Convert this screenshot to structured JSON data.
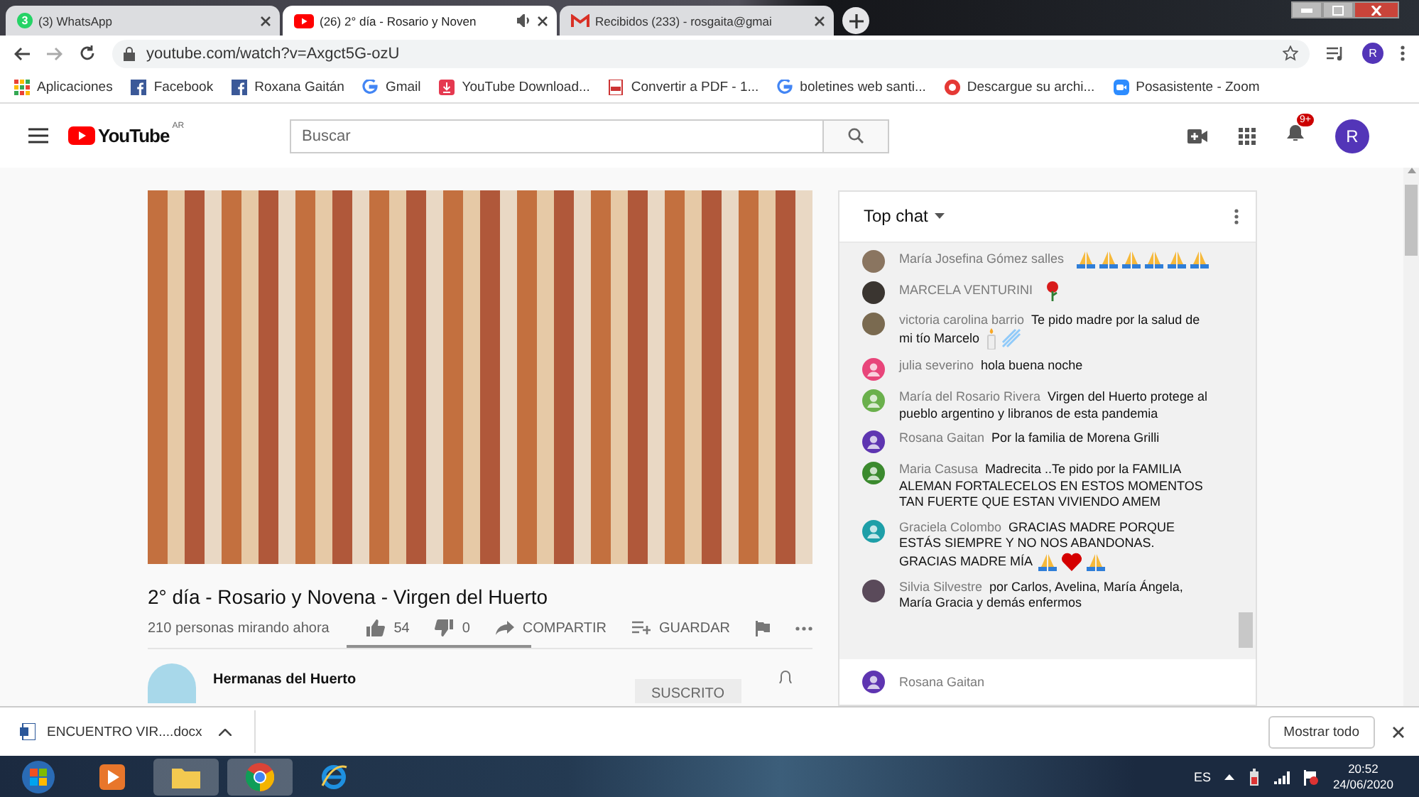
{
  "browser_tabs": [
    {
      "title": "(3) WhatsApp",
      "kind": "whatsapp",
      "badge": "3",
      "selected": false,
      "audio": false
    },
    {
      "title": "(26) 2° día - Rosario y Noven",
      "kind": "video",
      "selected": true,
      "audio": true
    },
    {
      "title": "Recibidos (233) - rosgaita@gmai",
      "kind": "mail",
      "selected": false,
      "audio": false
    }
  ],
  "address_bar": {
    "url": "youtube.com/watch?v=Axgct5G-ozU",
    "profile_initial": "R"
  },
  "bookmarks": [
    {
      "label": "Aplicaciones",
      "kind": "apps"
    },
    {
      "label": "Facebook",
      "kind": "social"
    },
    {
      "label": "Roxana Gaitán",
      "kind": "social"
    },
    {
      "label": "Gmail",
      "kind": "search"
    },
    {
      "label": "YouTube Download...",
      "kind": "download"
    },
    {
      "label": "Convertir a PDF - 1...",
      "kind": "document"
    },
    {
      "label": "boletines web santi...",
      "kind": "search"
    },
    {
      "label": "Descargue su archi...",
      "kind": "ring"
    },
    {
      "label": "Posasistente - Zoom",
      "kind": "camera"
    }
  ],
  "youtube_header": {
    "logo": "YouTube",
    "logo_region": "AR",
    "search_placeholder": "Buscar",
    "notification_count": "9+",
    "avatar_initial": "R"
  },
  "video": {
    "title": "2° día - Rosario y Novena - Virgen del Huerto",
    "viewers": "210 personas mirando ahora",
    "likes": "54",
    "dislikes": "0",
    "share": "COMPARTIR",
    "save": "GUARDAR",
    "like_bar": {
      "level": 1
    }
  },
  "channel": {
    "name": "Hermanas del Huerto",
    "subscribe": "SUSCRITO"
  },
  "chat": {
    "title": "Top chat",
    "messages": [
      {
        "author": "María Josefina Gómez salles",
        "emoji": [
          {
            "kind": "pray"
          },
          {
            "kind": "pray"
          },
          {
            "kind": "pray"
          },
          {
            "kind": "pray"
          },
          {
            "kind": "pray"
          },
          {
            "kind": "pray"
          }
        ],
        "kind": "photo",
        "color": "#8a7560"
      },
      {
        "author": "MARCELA VENTURINI",
        "emoji": [
          {
            "kind": "rose"
          }
        ],
        "kind": "photo",
        "color": "#3a3530"
      },
      {
        "author": "victoria carolina barrio",
        "text": "Te pido madre por la salud de mi tío Marcelo",
        "emoji": [
          {
            "kind": "candle"
          },
          {
            "kind": "comet"
          }
        ],
        "kind": "photo",
        "color": "#7a6a50"
      },
      {
        "author": "julia severino",
        "text": "hola buena noche",
        "kind": "default",
        "color": "#e8457a"
      },
      {
        "author": "María del Rosario Rivera",
        "text": "Virgen del Huerto protege al pueblo argentino y libranos de esta pandemia",
        "kind": "default",
        "color": "#6ab04c"
      },
      {
        "author": "Rosana Gaitan",
        "text": "Por la familia de Morena Grilli",
        "kind": "default",
        "color": "#5e35b1"
      },
      {
        "author": "Maria Casusa",
        "text": "Madrecita ..Te pido por la FAMILIA ALEMAN FORTALECELOS EN ESTOS MOMENTOS TAN FUERTE QUE ESTAN VIVIENDO AMEM",
        "kind": "default",
        "color": "#3b8a2e"
      },
      {
        "author": "Graciela Colombo",
        "text": "GRACIAS MADRE PORQUE ESTÁS SIEMPRE Y NO NOS ABANDONAS. GRACIAS MADRE MÍA",
        "emoji": [
          {
            "kind": "pray"
          },
          {
            "kind": "heart"
          },
          {
            "kind": "pray"
          }
        ],
        "kind": "default",
        "color": "#1e9fa8"
      },
      {
        "author": "Silvia Silvestre",
        "text": "por Carlos, Avelina, María Ángela, María Gracia y demás enfermos",
        "kind": "photo",
        "color": "#5a4a5a"
      }
    ],
    "pinned": {
      "author": "Rosana Gaitan",
      "color": "#5e35b1"
    }
  },
  "download_bar": {
    "file": "ENCUENTRO VIR....docx",
    "show_all": "Mostrar todo"
  },
  "taskbar": {
    "language": "ES",
    "time": "20:52",
    "date": "24/06/2020"
  }
}
